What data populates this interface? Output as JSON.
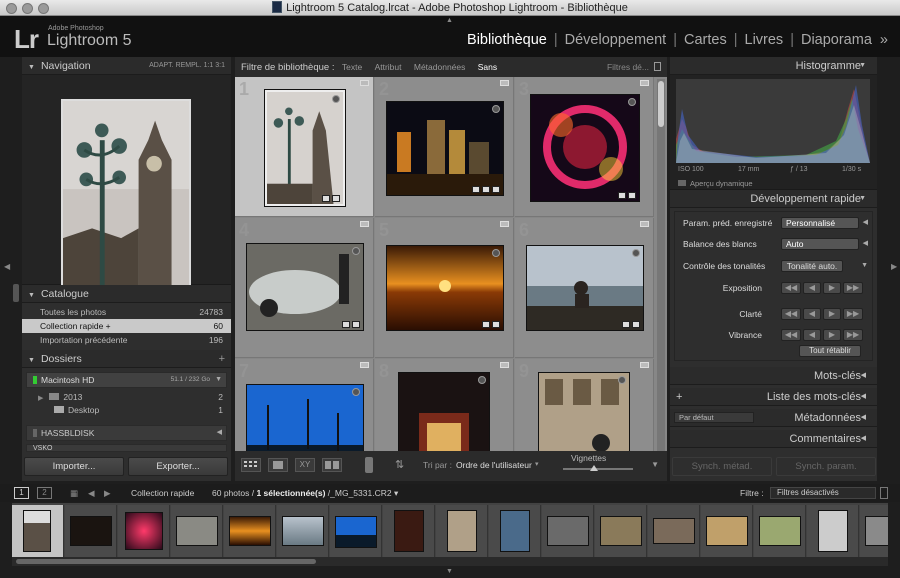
{
  "window": {
    "title": "Lightroom 5 Catalog.lrcat - Adobe Photoshop Lightroom - Bibliothèque"
  },
  "logo": {
    "mark": "Lr",
    "company": "Adobe Photoshop",
    "product": "Lightroom 5"
  },
  "modules": [
    {
      "label": "Bibliothèque",
      "active": true
    },
    {
      "label": "Développement"
    },
    {
      "label": "Cartes"
    },
    {
      "label": "Livres"
    },
    {
      "label": "Diaporama"
    }
  ],
  "modules_more": "»",
  "navigation": {
    "title": "Navigation",
    "opts": "ADAPT.   REMPL.   1:1   3:1"
  },
  "catalogue": {
    "title": "Catalogue",
    "items": [
      {
        "label": "Toutes les photos",
        "count": "24783"
      },
      {
        "label": "Collection rapide +",
        "count": "60",
        "selected": true
      },
      {
        "label": "Importation précédente",
        "count": "196"
      }
    ]
  },
  "dossiers": {
    "title": "Dossiers",
    "add": "+",
    "drive": {
      "label": "Macintosh HD",
      "space": "51.1 / 232 Go"
    },
    "folders": [
      {
        "label": "2013",
        "count": "2"
      },
      {
        "label": "Desktop",
        "count": "1"
      }
    ],
    "disks": [
      "HASSBLDISK",
      "VSKO"
    ]
  },
  "left_buttons": {
    "import": "Importer...",
    "export": "Exporter..."
  },
  "filter": {
    "title": "Filtre de bibliothèque :",
    "options": [
      "Texte",
      "Attribut",
      "Métadonnées",
      "Sans"
    ],
    "selected": "Sans",
    "presets": "Filtres dé..."
  },
  "grid": {
    "indices": [
      "1",
      "2",
      "3",
      "4",
      "5",
      "6",
      "7",
      "8",
      "9"
    ]
  },
  "toolbar": {
    "sort_label": "Tri par :",
    "sort_value": "Ordre de l'utilisateur",
    "vignettes": "Vignettes"
  },
  "histogram": {
    "title": "Histogramme",
    "iso": "ISO 100",
    "focal": "17 mm",
    "aperture": "ƒ / 13",
    "shutter": "1/30 s",
    "smart_preview": "Aperçu dynamique"
  },
  "quick_develop": {
    "title": "Développement rapide",
    "preset_label": "Param. préd. enregistré",
    "preset_value": "Personnalisé",
    "wb_label": "Balance des blancs",
    "wb_value": "Auto",
    "tone_label": "Contrôle des tonalités",
    "tone_auto": "Tonalité auto.",
    "exposure": "Exposition",
    "clarity": "Clarté",
    "vibrance": "Vibrance",
    "reset": "Tout rétablir"
  },
  "keywords": {
    "title": "Mots-clés"
  },
  "keyword_list": {
    "title": "Liste des mots-clés",
    "add": "+"
  },
  "metadata": {
    "title": "Métadonnées",
    "preset": "Par défaut"
  },
  "comments": {
    "title": "Commentaires"
  },
  "right_buttons": {
    "sync_meta": "Synch. métad.",
    "sync_params": "Synch. param."
  },
  "filmstrip_bar": {
    "screen1": "1",
    "screen2": "2",
    "source": "Collection rapide",
    "info_prefix": "60 photos /",
    "info_sel": "1 sélectionnée(s)",
    "info_file": "/_MG_5331.CR2",
    "filter_label": "Filtre :",
    "filter_value": "Filtres désactivés"
  }
}
